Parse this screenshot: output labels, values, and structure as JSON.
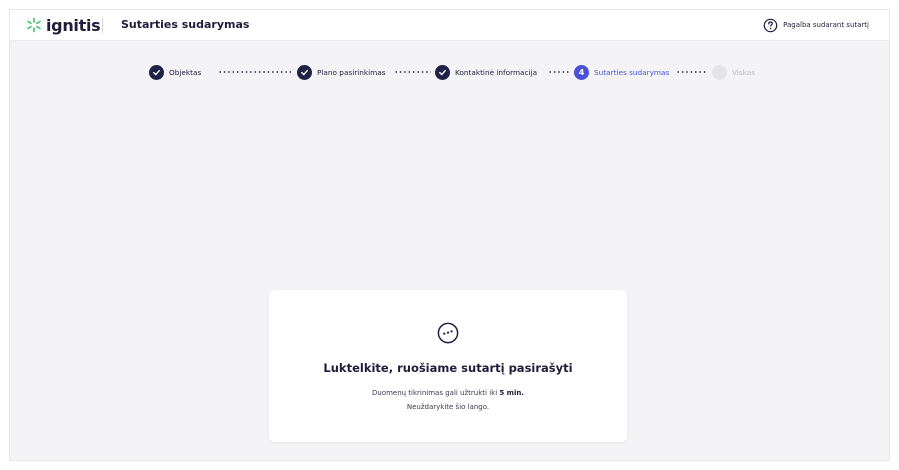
{
  "header": {
    "logo_text": "ignitis",
    "title": "Sutarties sudarymas",
    "help_label": "Pagalba sudarant sutartį",
    "help_icon": "question-circle-icon",
    "logo_icon": "ignitis-star-icon"
  },
  "stepper": {
    "steps": [
      {
        "label": "Objektas",
        "state": "done"
      },
      {
        "label": "Plano pasirinkimas",
        "state": "done"
      },
      {
        "label": "Kontaktinė informacija",
        "state": "done"
      },
      {
        "label": "Sutarties sudarymas",
        "state": "active",
        "number": "4"
      },
      {
        "label": "Viskas",
        "state": "pending"
      }
    ]
  },
  "card": {
    "icon": "loading-dots-icon",
    "title": "Luktelkite, ruošiame sutartį pasirašyti",
    "line1_prefix": "Duomenų tikrinimas gali užtrukti iki ",
    "line1_bold": "5 min.",
    "line2": "Neuždarykite šio lango."
  },
  "colors": {
    "accent": "#4b50d6",
    "brand_dark": "#1f2147",
    "logo_green": "#38c46a",
    "background": "#f4f4f6"
  }
}
